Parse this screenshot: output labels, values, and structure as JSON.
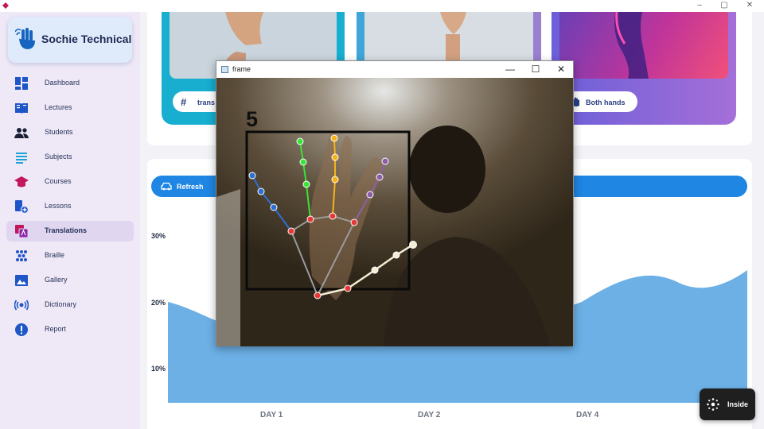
{
  "window": {
    "controls": {
      "minimize": "–",
      "maximize": "▢",
      "close": "✕"
    }
  },
  "brand": {
    "name": "Sochie Technical"
  },
  "sidebar": {
    "items": [
      {
        "label": "Dashboard",
        "icon": "dashboard-icon"
      },
      {
        "label": "Lectures",
        "icon": "book-icon"
      },
      {
        "label": "Students",
        "icon": "people-icon"
      },
      {
        "label": "Subjects",
        "icon": "list-icon"
      },
      {
        "label": "Courses",
        "icon": "graduation-cap-icon"
      },
      {
        "label": "Lessons",
        "icon": "lessons-icon"
      },
      {
        "label": "Translations",
        "icon": "translate-icon",
        "active": true
      },
      {
        "label": "Braille",
        "icon": "braille-icon"
      },
      {
        "label": "Gallery",
        "icon": "image-icon"
      },
      {
        "label": "Dictionary",
        "icon": "broadcast-icon"
      },
      {
        "label": "Report",
        "icon": "alert-icon"
      }
    ]
  },
  "cards": [
    {
      "chip": "trans"
    },
    {
      "chip": ""
    },
    {
      "chip": "Both hands"
    }
  ],
  "chart": {
    "refresh_label": "Refresh",
    "y_ticks": [
      "30%",
      "20%",
      "10%"
    ],
    "x_ticks": [
      "DAY 1",
      "DAY 2",
      "DAY 4"
    ]
  },
  "chart_data": {
    "type": "area",
    "x": [
      "DAY 1",
      "DAY 2",
      "DAY 4"
    ],
    "yticks": [
      "30%",
      "20%",
      "10%"
    ],
    "values": [
      18,
      21,
      25
    ],
    "grid": false
  },
  "frame": {
    "title": "frame",
    "detected_count": "5",
    "controls": {
      "minimize": "—",
      "maximize": "☐",
      "close": "✕"
    }
  },
  "floating_button": {
    "label": "Inside"
  },
  "colors": {
    "accent": "#1f86e3",
    "area_fill": "#6cb0e6",
    "card1": "#17aed0",
    "sidebar_bg": "#efe9f7"
  }
}
